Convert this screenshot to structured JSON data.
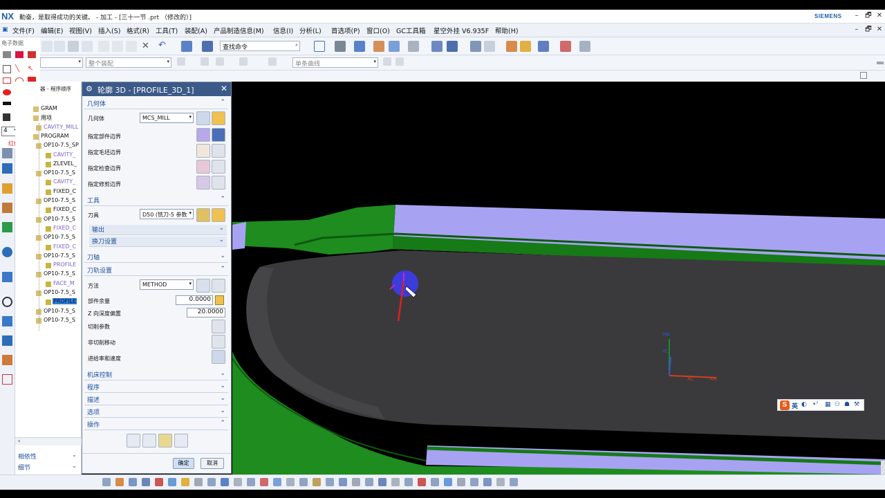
{
  "app": {
    "logo": "NX",
    "title": "勤奋，是取得成功的关键。 - 加工 - [三十一节 .prt （修改的）]",
    "brand": "SIEMENS",
    "window_controls": [
      "–",
      "🗗",
      "✕"
    ]
  },
  "menubar": {
    "items": [
      "文件(F)",
      "编辑(E)",
      "视图(V)",
      "插入(S)",
      "格式(R)",
      "工具(T)",
      "装配(A)",
      "产品制造信息(M)",
      "信息(I)",
      "分析(L)",
      "首选项(P)",
      "窗口(O)",
      "GC工具箱",
      "星空外挂 V6.935F",
      "帮助(H)"
    ]
  },
  "toolbar": {
    "search_placeholder": "查找命令",
    "assembly_filter": "整个装配",
    "curve_filter": "单条曲线"
  },
  "leftpanel": {
    "label": "电子数据",
    "line_width": "4",
    "watermark": "红仙软件"
  },
  "navigator": {
    "header": "器 - 程序顺序",
    "rows": [
      {
        "text": "GRAM",
        "indent": 36,
        "check": false,
        "sel": false
      },
      {
        "text": "用项",
        "indent": 36,
        "check": false,
        "sel": false
      },
      {
        "text": "CAVITY_MILL",
        "indent": 40,
        "check": false,
        "sel": false,
        "color": "#7a62c8"
      },
      {
        "text": "PROGRAM",
        "indent": 36,
        "check": false,
        "sel": false
      },
      {
        "text": "OP10-7.5_SP",
        "indent": 40,
        "check": false,
        "sel": false
      },
      {
        "text": "CAVITY_",
        "indent": 54,
        "check": false,
        "sel": false,
        "color": "#7a62c8"
      },
      {
        "text": "ZLEVEL_",
        "indent": 54,
        "check": false,
        "sel": false
      },
      {
        "text": "OP10-7.5_S",
        "indent": 40,
        "check": false,
        "sel": false
      },
      {
        "text": "CAVITY_",
        "indent": 54,
        "check": false,
        "sel": false,
        "color": "#7a62c8"
      },
      {
        "text": "FIXED_C",
        "indent": 54,
        "check": false,
        "sel": false
      },
      {
        "text": "OP10-7.5_S",
        "indent": 40,
        "check": false,
        "sel": false
      },
      {
        "text": "FIXED_C",
        "indent": 54,
        "check": false,
        "sel": false
      },
      {
        "text": "OP10-7.5_S",
        "indent": 40,
        "check": false,
        "sel": false
      },
      {
        "text": "FIXED_C",
        "indent": 54,
        "check": false,
        "sel": false,
        "color": "#7a62c8"
      },
      {
        "text": "OP10-7.5_S",
        "indent": 40,
        "check": false,
        "sel": false
      },
      {
        "text": "FIXED_C",
        "indent": 54,
        "check": false,
        "sel": false,
        "color": "#7a62c8"
      },
      {
        "text": "OP10-7.5_S",
        "indent": 40,
        "check": false,
        "sel": false
      },
      {
        "text": "PROFILE",
        "indent": 54,
        "check": false,
        "sel": false,
        "color": "#7a62c8"
      },
      {
        "text": "OP10-7.5_S",
        "indent": 40,
        "check": false,
        "sel": false
      },
      {
        "text": "FACE_M",
        "indent": 54,
        "check": false,
        "sel": false,
        "color": "#7a62c8"
      },
      {
        "text": "OP10-7.5_S",
        "indent": 40,
        "check": false,
        "sel": false
      },
      {
        "text": "PROFILE",
        "indent": 54,
        "check": false,
        "sel": true
      },
      {
        "text": "OP10-7.5_S",
        "indent": 40,
        "check": true,
        "sel": false
      },
      {
        "text": "OP10-7.5_S",
        "indent": 40,
        "check": true,
        "sel": false
      }
    ],
    "bottom": [
      "相依性",
      "细节"
    ]
  },
  "dialog": {
    "title": "轮廓 3D - [PROFILE_3D_1]",
    "sections": {
      "geometry": "几何体",
      "tool": "工具",
      "output": "输出",
      "tool_change": "换刀设置",
      "tool_axis": "刀轴",
      "path_settings": "刀轨设置",
      "machine_control": "机床控制",
      "program": "程序",
      "description": "描述",
      "options": "选项",
      "actions": "操作"
    },
    "geometry_label": "几何体",
    "geometry_value": "MCS_MILL",
    "specify_part_boundary": "指定部件边界",
    "specify_blank_boundary": "指定毛坯边界",
    "specify_check_boundary": "指定检查边界",
    "specify_trim_boundary": "指定修剪边界",
    "tool_label": "刀具",
    "tool_value": "D50 (铣刀-5 参数",
    "method_label": "方法",
    "method_value": "METHOD",
    "part_stock_label": "部件余量",
    "part_stock_value": "0.0000",
    "z_depth_label": "Z 向深度偏置",
    "z_depth_value": "20.0000",
    "cut_params": "切削参数",
    "non_cut_moves": "非切削移动",
    "feeds_speeds": "进给率和速度",
    "ok": "确定",
    "cancel": "取消"
  },
  "viewport": {
    "axis_labels": {
      "ym": "YM",
      "yc": "YC",
      "xc": "XC",
      "xm": "XM"
    },
    "ime_text": "英"
  },
  "colors": {
    "title_blue": "#1b5ea8",
    "dialog_title": "#3c5a88",
    "part_gray": "#3a3a3c",
    "wall_green": "#1e8c1e",
    "floor_lavender": "#a7a3f2",
    "tool_blue": "#3c3cdc",
    "selected_blue": "#2f7de1"
  }
}
